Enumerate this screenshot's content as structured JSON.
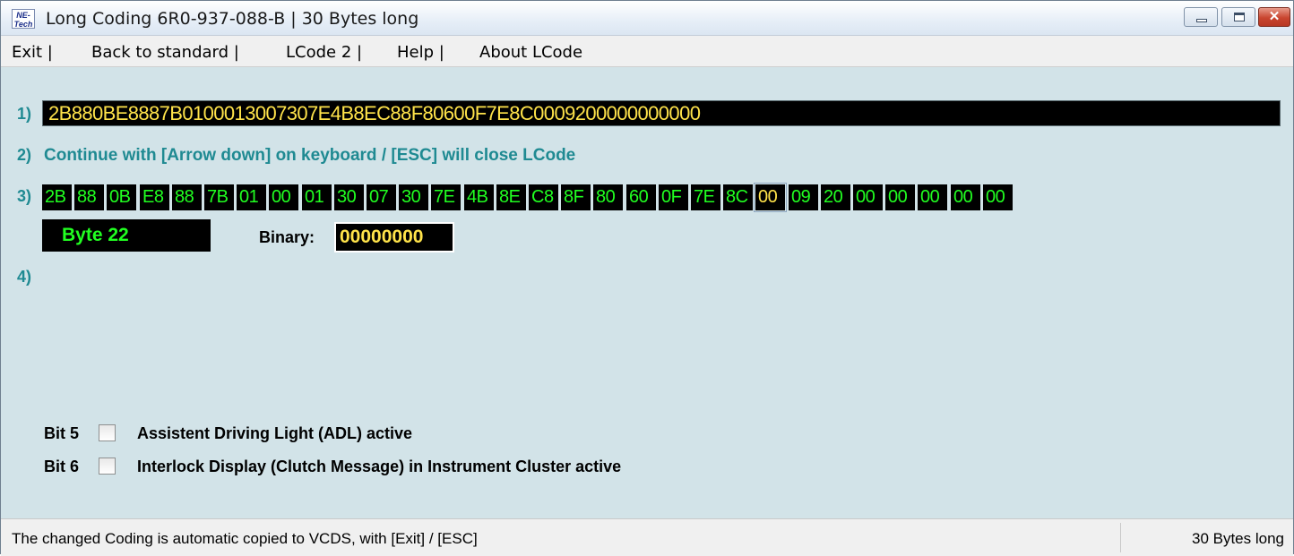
{
  "window": {
    "logo_text": "NE-Tech",
    "title": "Long Coding  6R0-937-088-B | 30 Bytes long",
    "controls": {
      "close": "✕"
    }
  },
  "menu": {
    "items": [
      "Exit |",
      "Back to standard |",
      "LCode 2 |",
      "Help |",
      "About LCode"
    ]
  },
  "rows": {
    "r1": "1)",
    "r2": "2)",
    "r3": "3)",
    "r4": "4)"
  },
  "coding": {
    "value": "2B880BE8887B0100013007307E4B8EC88F80600F7E8C0009200000000000"
  },
  "info": "Continue with [Arrow down] on keyboard / [ESC] will close LCode",
  "bytes": [
    "2B",
    "88",
    "0B",
    "E8",
    "88",
    "7B",
    "01",
    "00",
    "01",
    "30",
    "07",
    "30",
    "7E",
    "4B",
    "8E",
    "C8",
    "8F",
    "80",
    "60",
    "0F",
    "7E",
    "8C",
    "00",
    "09",
    "20",
    "00",
    "00",
    "00",
    "00",
    "00"
  ],
  "selected_byte_index": 22,
  "byte_detail": {
    "label": "Byte 22",
    "binary_label": "Binary:",
    "binary_value": "00000000"
  },
  "bits": [
    {
      "label": "Bit 5",
      "checked": false,
      "description": "Assistent Driving Light (ADL) active"
    },
    {
      "label": "Bit 6",
      "checked": false,
      "description": "Interlock Display (Clutch Message) in Instrument Cluster active"
    }
  ],
  "status": {
    "left": "The changed Coding is automatic copied to VCDS, with [Exit] / [ESC]",
    "right": "30 Bytes long"
  },
  "colors": {
    "background": "#d2e3e8",
    "accent_teal": "#1f8a92",
    "hex_green": "#21ff21",
    "hex_yellow": "#ffe34a"
  }
}
